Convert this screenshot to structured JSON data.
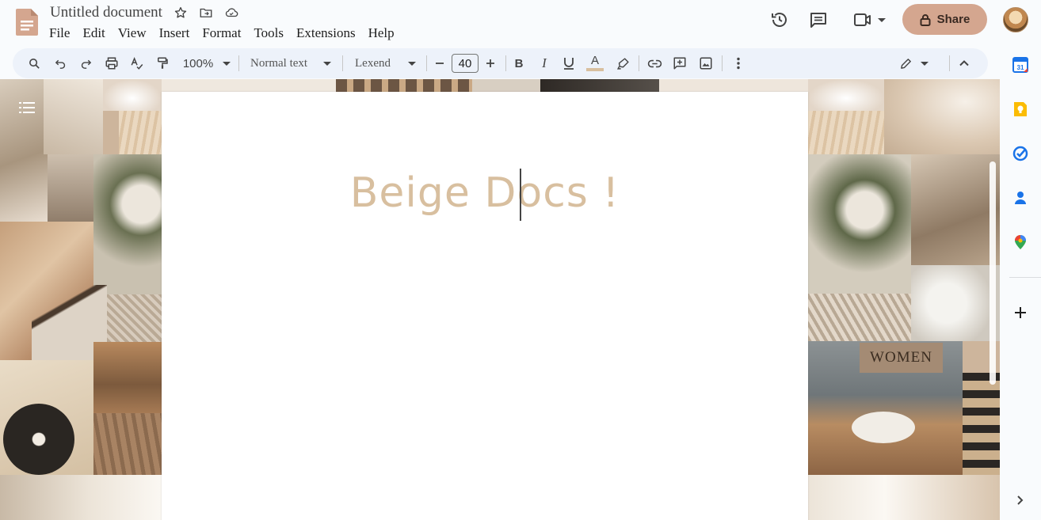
{
  "document": {
    "title": "Untitled document",
    "heading": "Beige Docs !"
  },
  "menu": [
    "File",
    "Edit",
    "View",
    "Insert",
    "Format",
    "Tools",
    "Extensions",
    "Help"
  ],
  "header": {
    "share_label": "Share"
  },
  "toolbar": {
    "zoom": "100%",
    "style": "Normal text",
    "font": "Lexend",
    "font_size": "40"
  },
  "canvas": {
    "collage_label": "WOMEN"
  },
  "colors": {
    "share_bg": "#d4a68f",
    "heading": "#d8bf9f",
    "toolbar_bg": "#edf2fa"
  },
  "icons": [
    "docs-logo",
    "star-icon",
    "move-to-folder-icon",
    "cloud-saved-icon",
    "history-icon",
    "comments-icon",
    "meet-icon",
    "lock-icon",
    "search-icon",
    "undo-icon",
    "redo-icon",
    "print-icon",
    "spellcheck-icon",
    "paint-format-icon",
    "minus-icon",
    "plus-icon",
    "bold-icon",
    "italic-icon",
    "underline-icon",
    "text-color-icon",
    "highlight-icon",
    "link-icon",
    "add-comment-icon",
    "insert-image-icon",
    "more-vert-icon",
    "edit-mode-icon",
    "collapse-icon",
    "calendar-icon",
    "keep-icon",
    "tasks-icon",
    "contacts-icon",
    "maps-icon",
    "add-icon",
    "expand-panel-icon"
  ]
}
